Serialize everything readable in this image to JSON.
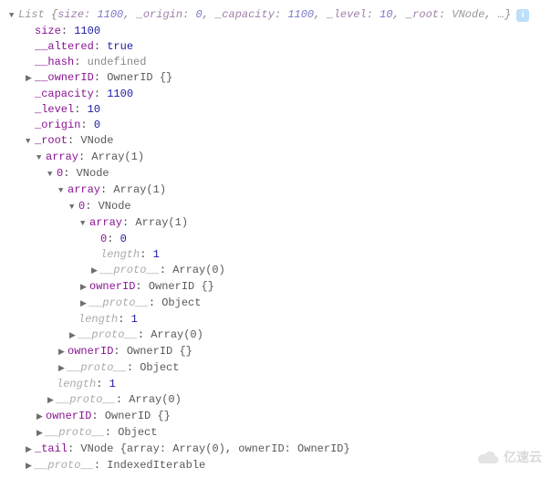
{
  "header": {
    "label": "List",
    "summary": "{size: 1100, _origin: 0, _capacity: 1100, _level: 10, _root: VNode, …}"
  },
  "props": {
    "size": {
      "k": "size",
      "v": "1100"
    },
    "altered": {
      "k": "__altered",
      "v": "true"
    },
    "hash": {
      "k": "__hash",
      "v": "undefined"
    },
    "ownerID": {
      "k": "__ownerID",
      "v": "OwnerID {}"
    },
    "capacity": {
      "k": "_capacity",
      "v": "1100"
    },
    "level": {
      "k": "_level",
      "v": "10"
    },
    "origin": {
      "k": "_origin",
      "v": "0"
    },
    "root": {
      "k": "_root",
      "v": "VNode"
    },
    "tail": {
      "k": "_tail",
      "v": "VNode {array: Array(0), ownerID: OwnerID}"
    },
    "proto": {
      "k": "__proto__",
      "v": "IndexedIterable"
    }
  },
  "array": {
    "label": "array",
    "type": "Array(1)",
    "idx0": "0",
    "vnode": "VNode",
    "zero": "0",
    "length_k": "length",
    "length_v": "1",
    "proto_k": "__proto__",
    "proto_arr": "Array(0)",
    "proto_obj": "Object",
    "ownerID_k": "ownerID",
    "ownerID_v": "OwnerID {}"
  },
  "watermark": "亿速云"
}
